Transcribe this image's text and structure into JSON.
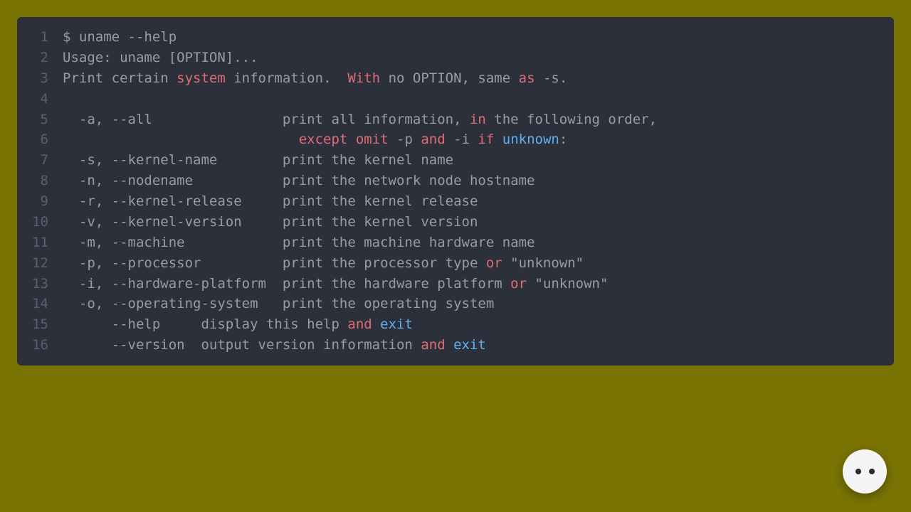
{
  "colors": {
    "background": "#7a7405",
    "code_bg": "#2b303b",
    "text": "#969da8",
    "line_number": "#5a6070",
    "red": "#e06c75",
    "blue": "#61afef"
  },
  "code": {
    "lines": [
      {
        "num": "1",
        "tokens": [
          {
            "t": "$ uname ",
            "c": ""
          },
          {
            "t": "--help",
            "c": ""
          }
        ]
      },
      {
        "num": "2",
        "tokens": [
          {
            "t": "Usage: uname [OPTION]...",
            "c": ""
          }
        ]
      },
      {
        "num": "3",
        "tokens": [
          {
            "t": "Print certain ",
            "c": ""
          },
          {
            "t": "system",
            "c": "red"
          },
          {
            "t": " information.  ",
            "c": ""
          },
          {
            "t": "With",
            "c": "red"
          },
          {
            "t": " no OPTION, same ",
            "c": ""
          },
          {
            "t": "as",
            "c": "red"
          },
          {
            "t": " -s.",
            "c": ""
          }
        ]
      },
      {
        "num": "4",
        "tokens": [
          {
            "t": "",
            "c": ""
          }
        ]
      },
      {
        "num": "5",
        "tokens": [
          {
            "t": "  -a, --all                print all information, ",
            "c": ""
          },
          {
            "t": "in",
            "c": "red"
          },
          {
            "t": " the following order,",
            "c": ""
          }
        ]
      },
      {
        "num": "6",
        "tokens": [
          {
            "t": "                             ",
            "c": ""
          },
          {
            "t": "except",
            "c": "red"
          },
          {
            "t": " ",
            "c": ""
          },
          {
            "t": "omit",
            "c": "red"
          },
          {
            "t": " -p ",
            "c": ""
          },
          {
            "t": "and",
            "c": "red"
          },
          {
            "t": " -i ",
            "c": ""
          },
          {
            "t": "if",
            "c": "red"
          },
          {
            "t": " ",
            "c": ""
          },
          {
            "t": "unknown",
            "c": "blue"
          },
          {
            "t": ":",
            "c": ""
          }
        ]
      },
      {
        "num": "7",
        "tokens": [
          {
            "t": "  -s, --kernel-name        print the kernel name",
            "c": ""
          }
        ]
      },
      {
        "num": "8",
        "tokens": [
          {
            "t": "  -n, --nodename           print the network node hostname",
            "c": ""
          }
        ]
      },
      {
        "num": "9",
        "tokens": [
          {
            "t": "  -r, --kernel-release     print the kernel release",
            "c": ""
          }
        ]
      },
      {
        "num": "10",
        "tokens": [
          {
            "t": "  -v, --kernel-version     print the kernel version",
            "c": ""
          }
        ]
      },
      {
        "num": "11",
        "tokens": [
          {
            "t": "  -m, --machine            print the machine hardware name",
            "c": ""
          }
        ]
      },
      {
        "num": "12",
        "tokens": [
          {
            "t": "  -p, --processor          print the processor type ",
            "c": ""
          },
          {
            "t": "or",
            "c": "red"
          },
          {
            "t": " \"unknown\"",
            "c": ""
          }
        ]
      },
      {
        "num": "13",
        "tokens": [
          {
            "t": "  -i, --hardware-platform  print the hardware platform ",
            "c": ""
          },
          {
            "t": "or",
            "c": "red"
          },
          {
            "t": " \"unknown\"",
            "c": ""
          }
        ]
      },
      {
        "num": "14",
        "tokens": [
          {
            "t": "  -o, --operating-system   print the operating system",
            "c": ""
          }
        ]
      },
      {
        "num": "15",
        "tokens": [
          {
            "t": "      --help     display this help ",
            "c": ""
          },
          {
            "t": "and",
            "c": "red"
          },
          {
            "t": " ",
            "c": ""
          },
          {
            "t": "exit",
            "c": "blue"
          }
        ]
      },
      {
        "num": "16",
        "tokens": [
          {
            "t": "      --version  output version information ",
            "c": ""
          },
          {
            "t": "and",
            "c": "red"
          },
          {
            "t": " ",
            "c": ""
          },
          {
            "t": "exit",
            "c": "blue"
          }
        ]
      }
    ]
  }
}
